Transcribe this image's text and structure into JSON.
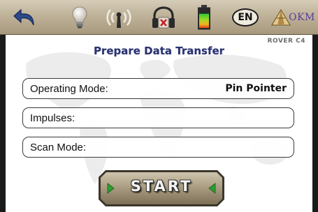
{
  "toolbar": {
    "back_icon": "back-arrow-icon",
    "lamp_icon": "light-bulb-icon",
    "signal_icon": "signal-antenna-icon",
    "headphones_icon": "headphones-muted-icon",
    "battery_icon": "battery-icon",
    "battery_level": 0.75,
    "language": "EN",
    "brand": "OKM"
  },
  "header": {
    "model": "ROVER C4",
    "title": "Prepare Data Transfer"
  },
  "fields": [
    {
      "label": "Operating Mode:",
      "value": "Pin Pointer"
    },
    {
      "label": "Impulses:",
      "value": ""
    },
    {
      "label": "Scan Mode:",
      "value": ""
    }
  ],
  "start_button": {
    "label": "START"
  },
  "colors": {
    "title": "#29326e",
    "accent_green": "#2e9d2e",
    "toolbar": "#c3b79f",
    "back_arrow": "#2c4a8a"
  }
}
